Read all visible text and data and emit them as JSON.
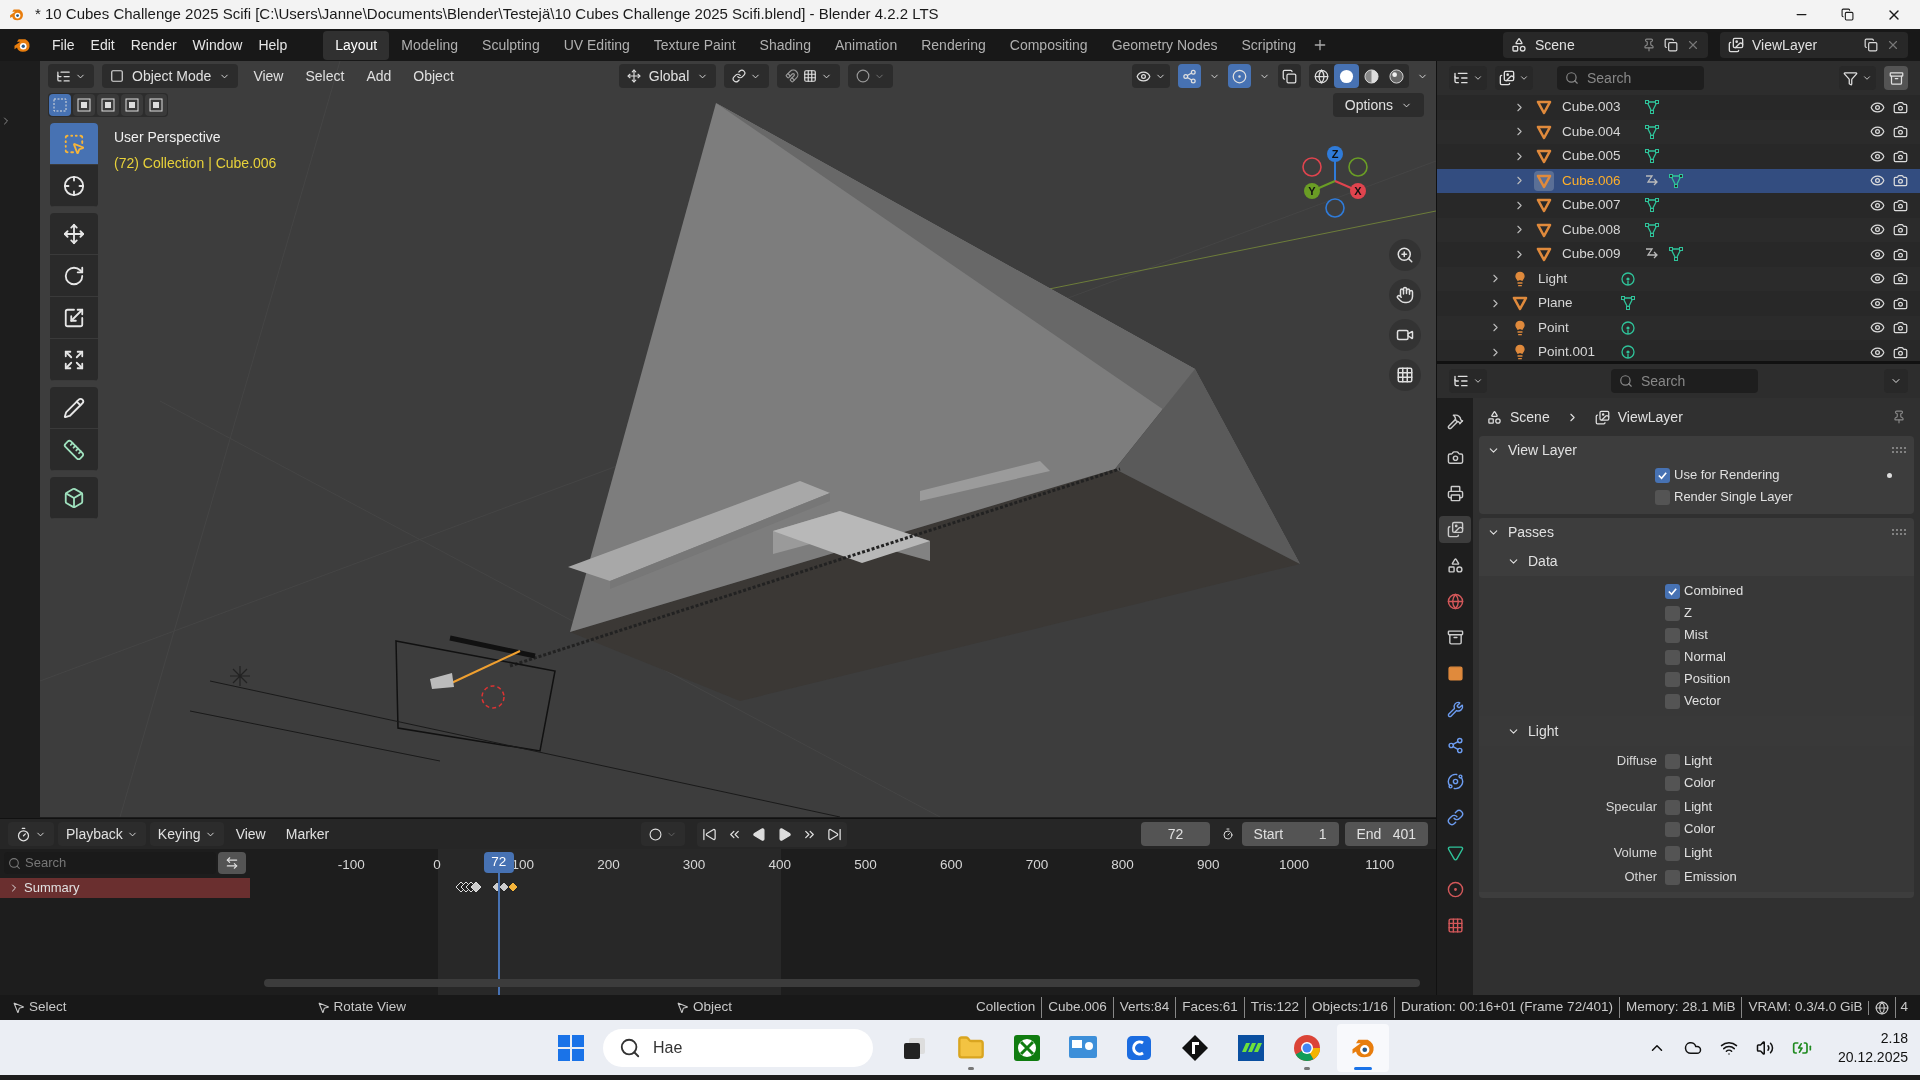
{
  "window": {
    "title": "* 10 Cubes Challenge 2025 Scifi [C:\\Users\\Janne\\Documents\\Blender\\Testejä\\10 Cubes Challenge 2025 Scifi.blend] - Blender 4.2.2 LTS"
  },
  "menu": [
    "File",
    "Edit",
    "Render",
    "Window",
    "Help"
  ],
  "workspaces": [
    {
      "label": "Layout",
      "selected": true
    },
    {
      "label": "Modeling",
      "selected": false
    },
    {
      "label": "Sculpting",
      "selected": false
    },
    {
      "label": "UV Editing",
      "selected": false
    },
    {
      "label": "Texture Paint",
      "selected": false
    },
    {
      "label": "Shading",
      "selected": false
    },
    {
      "label": "Animation",
      "selected": false
    },
    {
      "label": "Rendering",
      "selected": false
    },
    {
      "label": "Compositing",
      "selected": false
    },
    {
      "label": "Geometry Nodes",
      "selected": false
    },
    {
      "label": "Scripting",
      "selected": false
    }
  ],
  "scene": {
    "value": "Scene"
  },
  "view_layer": {
    "value": "ViewLayer"
  },
  "viewport": {
    "mode": "Object Mode",
    "menus": [
      "View",
      "Select",
      "Add",
      "Object"
    ],
    "orientation": "Global",
    "options": "Options",
    "view_name": "User Perspective",
    "context": "(72) Collection | Cube.006",
    "select_modes": [
      {
        "selected": true
      },
      {
        "selected": false
      },
      {
        "selected": false
      },
      {
        "selected": false
      },
      {
        "selected": false
      }
    ],
    "tools": [
      {
        "kind": "select-box",
        "selected": true
      },
      {
        "kind": "cursor",
        "selected": false
      },
      {
        "kind": "move",
        "selected": false
      },
      {
        "kind": "rotate",
        "selected": false
      },
      {
        "kind": "scale",
        "selected": false
      },
      {
        "kind": "transform",
        "selected": false
      },
      {
        "kind": "annotate",
        "selected": false
      },
      {
        "kind": "measure",
        "selected": false
      },
      {
        "kind": "add-cube",
        "selected": false
      }
    ],
    "shading": [
      {
        "kind": "wireframe",
        "selected": false
      },
      {
        "kind": "solid",
        "selected": true
      },
      {
        "kind": "material",
        "selected": false
      },
      {
        "kind": "rendered",
        "selected": false
      }
    ],
    "gizmo_axes": [
      {
        "label": "Z",
        "color": "#2f7bd9"
      },
      {
        "label": "Y",
        "color": "#6a9d25"
      },
      {
        "label": "X",
        "color": "#e0444e"
      }
    ]
  },
  "outliner": {
    "search": {
      "placeholder": "Search"
    },
    "nested_items": [
      {
        "name": "Cube.003",
        "kind": "mesh",
        "selected": false,
        "has_modifier": false
      },
      {
        "name": "Cube.004",
        "kind": "mesh",
        "selected": false,
        "has_modifier": false
      },
      {
        "name": "Cube.005",
        "kind": "mesh",
        "selected": false,
        "has_modifier": false
      },
      {
        "name": "Cube.006",
        "kind": "mesh",
        "selected": true,
        "has_modifier": true
      },
      {
        "name": "Cube.007",
        "kind": "mesh",
        "selected": false,
        "has_modifier": false
      },
      {
        "name": "Cube.008",
        "kind": "mesh",
        "selected": false,
        "has_modifier": false
      },
      {
        "name": "Cube.009",
        "kind": "mesh",
        "selected": false,
        "has_modifier": true
      }
    ],
    "items": [
      {
        "name": "Light",
        "kind": "light",
        "selected": false,
        "has_modifier": false
      },
      {
        "name": "Plane",
        "kind": "mesh",
        "selected": false,
        "has_modifier": false
      },
      {
        "name": "Point",
        "kind": "light",
        "selected": false,
        "has_modifier": false
      },
      {
        "name": "Point.001",
        "kind": "light",
        "selected": false,
        "has_modifier": false
      }
    ]
  },
  "properties": {
    "search": {
      "placeholder": "Search"
    },
    "tabs": [
      {
        "kind": "tool",
        "selected": false
      },
      {
        "kind": "render",
        "selected": false
      },
      {
        "kind": "output",
        "selected": false
      },
      {
        "kind": "view-layer",
        "selected": true
      },
      {
        "kind": "scene",
        "selected": false
      },
      {
        "kind": "world",
        "selected": false
      },
      {
        "kind": "collection",
        "selected": false
      },
      {
        "kind": "object",
        "selected": false
      },
      {
        "kind": "modifier",
        "selected": false
      },
      {
        "kind": "particles",
        "selected": false
      },
      {
        "kind": "physics",
        "selected": false
      },
      {
        "kind": "constraints",
        "selected": false
      },
      {
        "kind": "data",
        "selected": false
      },
      {
        "kind": "material",
        "selected": false
      },
      {
        "kind": "texture",
        "selected": false
      }
    ],
    "breadcrumb": [
      "Scene",
      "ViewLayer"
    ],
    "panels": [
      {
        "title": "View Layer",
        "expanded": true,
        "rows": [
          {
            "label": "Use for Rendering",
            "checked": true
          },
          {
            "label": "Render Single Layer",
            "checked": false
          }
        ]
      },
      {
        "title": "Passes",
        "expanded": true,
        "subpanels": [
          {
            "title": "Data",
            "expanded": true,
            "rows": [
              {
                "label": "Combined",
                "checked": true
              },
              {
                "label": "Z",
                "checked": false
              },
              {
                "label": "Mist",
                "checked": false
              },
              {
                "label": "Normal",
                "checked": false
              },
              {
                "label": "Position",
                "checked": false
              },
              {
                "label": "Vector",
                "checked": false
              }
            ]
          },
          {
            "title": "Light",
            "expanded": true,
            "rows": [
              {
                "group": "Diffuse",
                "label": "Light",
                "checked": false
              },
              {
                "label": "Color",
                "checked": false
              },
              {
                "group": "Specular",
                "label": "Light",
                "checked": false
              },
              {
                "label": "Color",
                "checked": false
              },
              {
                "group": "Volume",
                "label": "Light",
                "checked": false
              },
              {
                "group": "Other",
                "label": "Emission",
                "checked": false
              }
            ]
          }
        ]
      }
    ]
  },
  "timeline": {
    "menus": [
      "Playback",
      "Keying",
      "View",
      "Marker"
    ],
    "current_frame": "72",
    "start_label": "Start",
    "start": "1",
    "end_label": "End",
    "end": "401",
    "search": {
      "placeholder": "Search"
    },
    "ruler": [
      "-100",
      "0",
      "100",
      "200",
      "300",
      "400",
      "500",
      "600",
      "700",
      "800",
      "900",
      "1000",
      "1100"
    ],
    "frame_badge": "72",
    "channel": "Summary"
  },
  "status_bar": {
    "hints": [
      "Select",
      "Rotate View",
      "Object"
    ],
    "stats": [
      "Collection",
      "Cube.006",
      "Verts:84",
      "Faces:61",
      "Tris:122",
      "Objects:1/16",
      "Duration: 00:16+01 (Frame 72/401)",
      "Memory: 28.1 MiB",
      "VRAM: 0.3/4.0 GiB"
    ],
    "trailing": "4"
  },
  "taskbar": {
    "search": {
      "placeholder": "Hae"
    },
    "apps": [
      {
        "kind": "task-view",
        "running": false,
        "active": false
      },
      {
        "kind": "files",
        "running": true,
        "active": false
      },
      {
        "kind": "xbox",
        "running": false,
        "active": false
      },
      {
        "kind": "dashboard",
        "running": false,
        "active": false
      },
      {
        "kind": "c-app",
        "running": false,
        "active": false
      },
      {
        "kind": "f-app",
        "running": false,
        "active": false
      },
      {
        "kind": "bars-app",
        "running": false,
        "active": false
      },
      {
        "kind": "chrome",
        "running": true,
        "active": false
      },
      {
        "kind": "blender",
        "running": true,
        "active": true
      }
    ],
    "time": "2.18",
    "date": "20.12.2025"
  }
}
